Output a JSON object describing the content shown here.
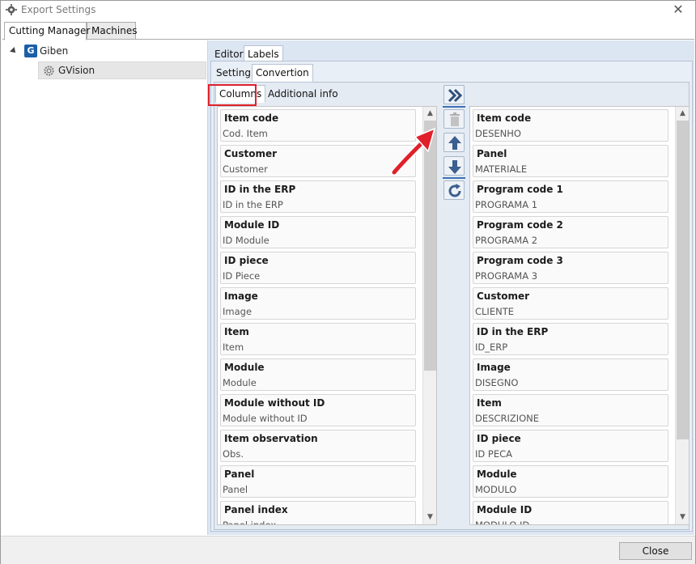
{
  "window": {
    "title": "Export Settings"
  },
  "main_tabs": [
    "Cutting Manager",
    "Machines"
  ],
  "tree": {
    "root": "Giben",
    "child": "GVision"
  },
  "right_tabs": [
    "Editor",
    "Labels"
  ],
  "labels_tabs": [
    "Setting",
    "Convertion"
  ],
  "conversion_tabs": [
    "Columns",
    "Additional info"
  ],
  "left_list": [
    {
      "title": "Item code",
      "sub": "Cod. Item"
    },
    {
      "title": "Customer",
      "sub": "Customer"
    },
    {
      "title": "ID in the ERP",
      "sub": "ID in the ERP"
    },
    {
      "title": "Module ID",
      "sub": "ID Module"
    },
    {
      "title": "ID piece",
      "sub": "ID Piece"
    },
    {
      "title": "Image",
      "sub": "Image"
    },
    {
      "title": "Item",
      "sub": "Item"
    },
    {
      "title": "Module",
      "sub": "Module"
    },
    {
      "title": "Module without ID",
      "sub": "Module without ID"
    },
    {
      "title": "Item observation",
      "sub": "Obs."
    },
    {
      "title": "Panel",
      "sub": "Panel"
    },
    {
      "title": "Panel index",
      "sub": "Panel index"
    }
  ],
  "right_list": [
    {
      "title": "Item code",
      "sub": "DESENHO"
    },
    {
      "title": "Panel",
      "sub": "MATERIALE"
    },
    {
      "title": "Program code 1",
      "sub": "PROGRAMA 1"
    },
    {
      "title": "Program code 2",
      "sub": "PROGRAMA 2"
    },
    {
      "title": "Program code 3",
      "sub": "PROGRAMA 3"
    },
    {
      "title": "Customer",
      "sub": "CLIENTE"
    },
    {
      "title": "ID in the ERP",
      "sub": "ID_ERP"
    },
    {
      "title": "Image",
      "sub": "DISEGNO"
    },
    {
      "title": "Item",
      "sub": "DESCRIZIONE"
    },
    {
      "title": "ID piece",
      "sub": "ID PECA"
    },
    {
      "title": "Module",
      "sub": "MODULO"
    },
    {
      "title": "Module ID",
      "sub": "MODULO ID"
    }
  ],
  "toolbar": [
    "add-all-icon",
    "delete-icon",
    "move-up-icon",
    "move-down-icon",
    "reset-icon"
  ],
  "footer": {
    "close_label": "Close"
  },
  "colors": {
    "accent": "#3d6fb6",
    "highlight": "#e0202a",
    "panel": "#dce6f2"
  }
}
